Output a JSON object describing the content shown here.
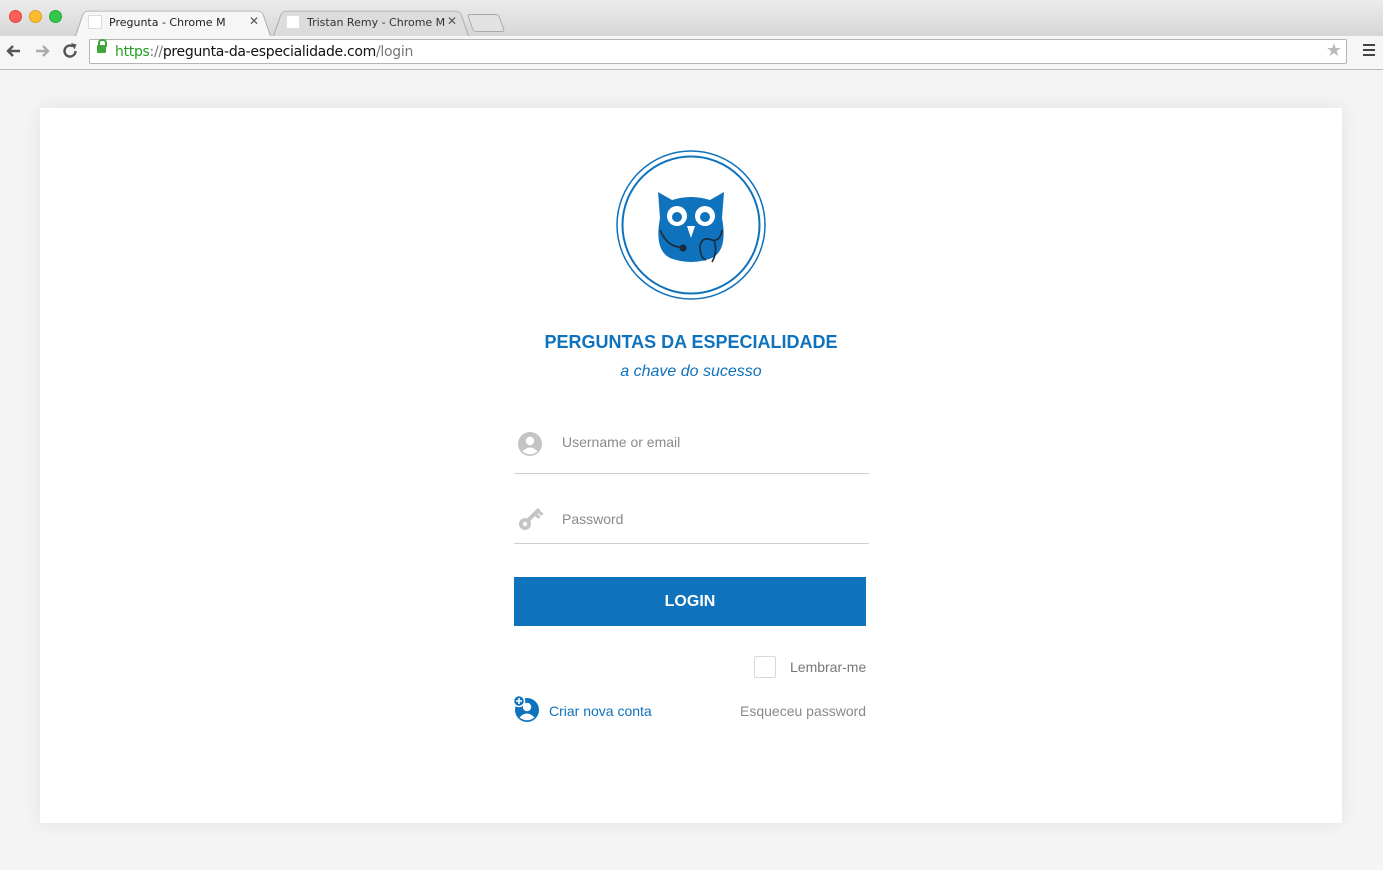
{
  "browser": {
    "tabs": [
      {
        "title": "Pregunta - Chrome M",
        "active": true
      },
      {
        "title": "Tristan Remy - Chrome M",
        "active": false
      }
    ],
    "url": {
      "scheme": "https",
      "separator": "://",
      "host": "pregunta-da-especialidade.com",
      "path": "/login"
    }
  },
  "brand": {
    "name": "PERGUNTAS DA ESPECIALIDADE",
    "tagline": "a chave do sucesso"
  },
  "form": {
    "username_placeholder": "Username or email",
    "username_value": "",
    "password_placeholder": "Password",
    "password_value": "",
    "login_label": "LOGIN",
    "remember_label": "Lembrar-me",
    "remember_checked": false,
    "create_account_label": "Criar nova conta",
    "forgot_password_label": "Esqueceu password"
  },
  "icons": {
    "logo": "owl-logo-icon",
    "username": "user-circle-icon",
    "password": "key-icon",
    "create_account": "add-user-icon",
    "bookmark": "star-icon",
    "secure": "lock-icon"
  },
  "colors": {
    "accent": "#0f72bd",
    "placeholder": "#8a8a8a",
    "icon_gray": "#c4c4c4",
    "secure_green": "#22a021"
  }
}
